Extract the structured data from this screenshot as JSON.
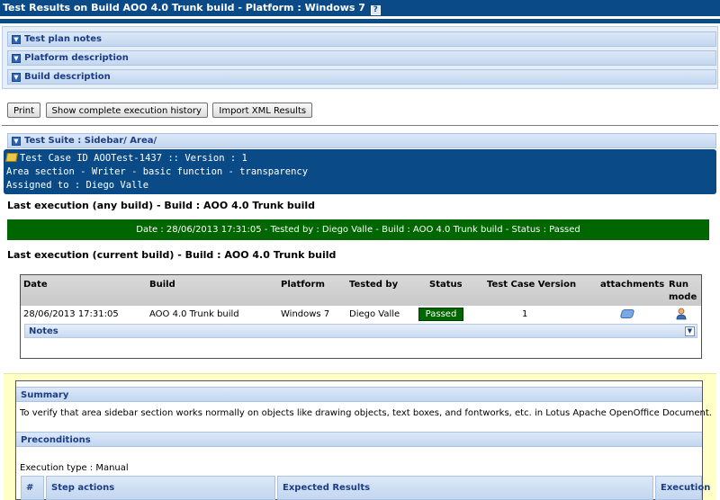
{
  "window": {
    "title": "Test Results on Build AOO 4.0 Trunk build - Platform : Windows 7",
    "help_icon": "help-icon"
  },
  "sections": {
    "test_plan_notes": "Test plan notes",
    "platform_description": "Platform description",
    "build_description": "Build description",
    "test_suite": "Test Suite : Sidebar/ Area/"
  },
  "toolbar": {
    "print": "Print",
    "history": "Show complete execution history",
    "import_xml": "Import XML Results"
  },
  "test_case": {
    "line1": "Test Case ID AOOTest-1437 :: Version : 1",
    "line2": "Area section - Writer - basic function - transparency",
    "line3": "Assigned to : Diego Valle"
  },
  "execution": {
    "last_any_heading": "Last execution (any build) - Build : AOO 4.0 Trunk build",
    "banner": "Date : 28/06/2013 17:31:05 - Tested by : Diego Valle - Build : AOO 4.0 Trunk build - Status : Passed",
    "last_current_heading": "Last execution (current build) - Build : AOO 4.0 Trunk build",
    "colors": {
      "passed": "#006600",
      "header": "#0a4a86"
    }
  },
  "exec_table": {
    "headers": {
      "date": "Date",
      "build": "Build",
      "platform": "Platform",
      "tested_by": "Tested by",
      "status": "Status",
      "tc_version": "Test Case Version",
      "attachments": "attachments",
      "run_mode_1": "Run",
      "run_mode_2": "mode"
    },
    "row": {
      "date": "28/06/2013 17:31:05",
      "build": "AOO 4.0 Trunk build",
      "platform": "Windows 7",
      "tested_by": "Diego Valle",
      "status": "Passed",
      "tc_version": "1"
    },
    "notes_label": "Notes"
  },
  "spec": {
    "summary_label": "Summary",
    "summary_text": "To verify that area sidebar section works normally on objects like drawing objects, text boxes, and fontworks, etc. in Lotus Apache OpenOffice Document.",
    "preconditions_label": "Preconditions",
    "execution_type": "Execution type : Manual",
    "steps_headers": {
      "num": "#",
      "actions": "Step actions",
      "expected": "Expected Results",
      "execution": "Execution"
    }
  }
}
